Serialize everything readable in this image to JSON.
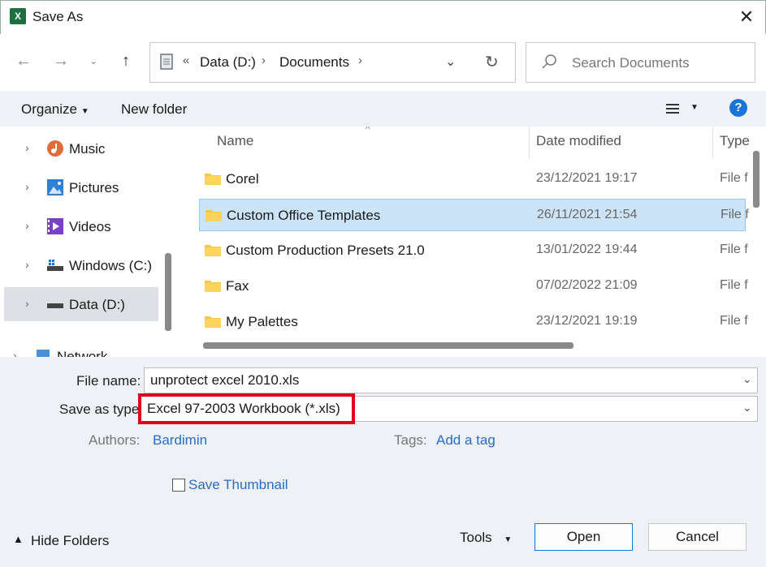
{
  "window": {
    "title": "Save As",
    "app_icon": "excel-icon"
  },
  "address": {
    "overflow": "«",
    "crumbs": [
      "Data (D:)",
      "Documents"
    ]
  },
  "search": {
    "placeholder": "Search Documents"
  },
  "toolbar": {
    "organize": "Organize",
    "new_folder": "New folder",
    "help": "?"
  },
  "nav": {
    "items": [
      {
        "label": "Music",
        "icon": "music-icon"
      },
      {
        "label": "Pictures",
        "icon": "pictures-icon"
      },
      {
        "label": "Videos",
        "icon": "videos-icon"
      },
      {
        "label": "Windows  (C:)",
        "icon": "drive-icon"
      },
      {
        "label": "Data (D:)",
        "icon": "drive-icon",
        "selected": true
      },
      {
        "label": "Network",
        "icon": "network-icon"
      }
    ]
  },
  "columns": {
    "name": "Name",
    "date": "Date modified",
    "type": "Type"
  },
  "files": [
    {
      "name": "Corel",
      "date": "23/12/2021 19:17",
      "type": "File f"
    },
    {
      "name": "Custom Office Templates",
      "date": "26/11/2021 21:54",
      "type": "File f",
      "selected": true
    },
    {
      "name": "Custom Production Presets 21.0",
      "date": "13/01/2022 19:44",
      "type": "File f"
    },
    {
      "name": "Fax",
      "date": "07/02/2022 21:09",
      "type": "File f"
    },
    {
      "name": "My Palettes",
      "date": "23/12/2021 19:19",
      "type": "File f"
    }
  ],
  "form": {
    "file_name_label": "File name:",
    "file_name_value": "unprotect excel 2010.xls",
    "save_type_label": "Save as type:",
    "save_type_value": "Excel 97-2003 Workbook (*.xls)",
    "authors_label": "Authors:",
    "authors_value": "Bardimin",
    "tags_label": "Tags:",
    "tags_value": "Add a tag",
    "thumbnail_label": "Save Thumbnail"
  },
  "footer": {
    "hide_folders": "Hide Folders",
    "tools": "Tools",
    "open": "Open",
    "cancel": "Cancel"
  }
}
